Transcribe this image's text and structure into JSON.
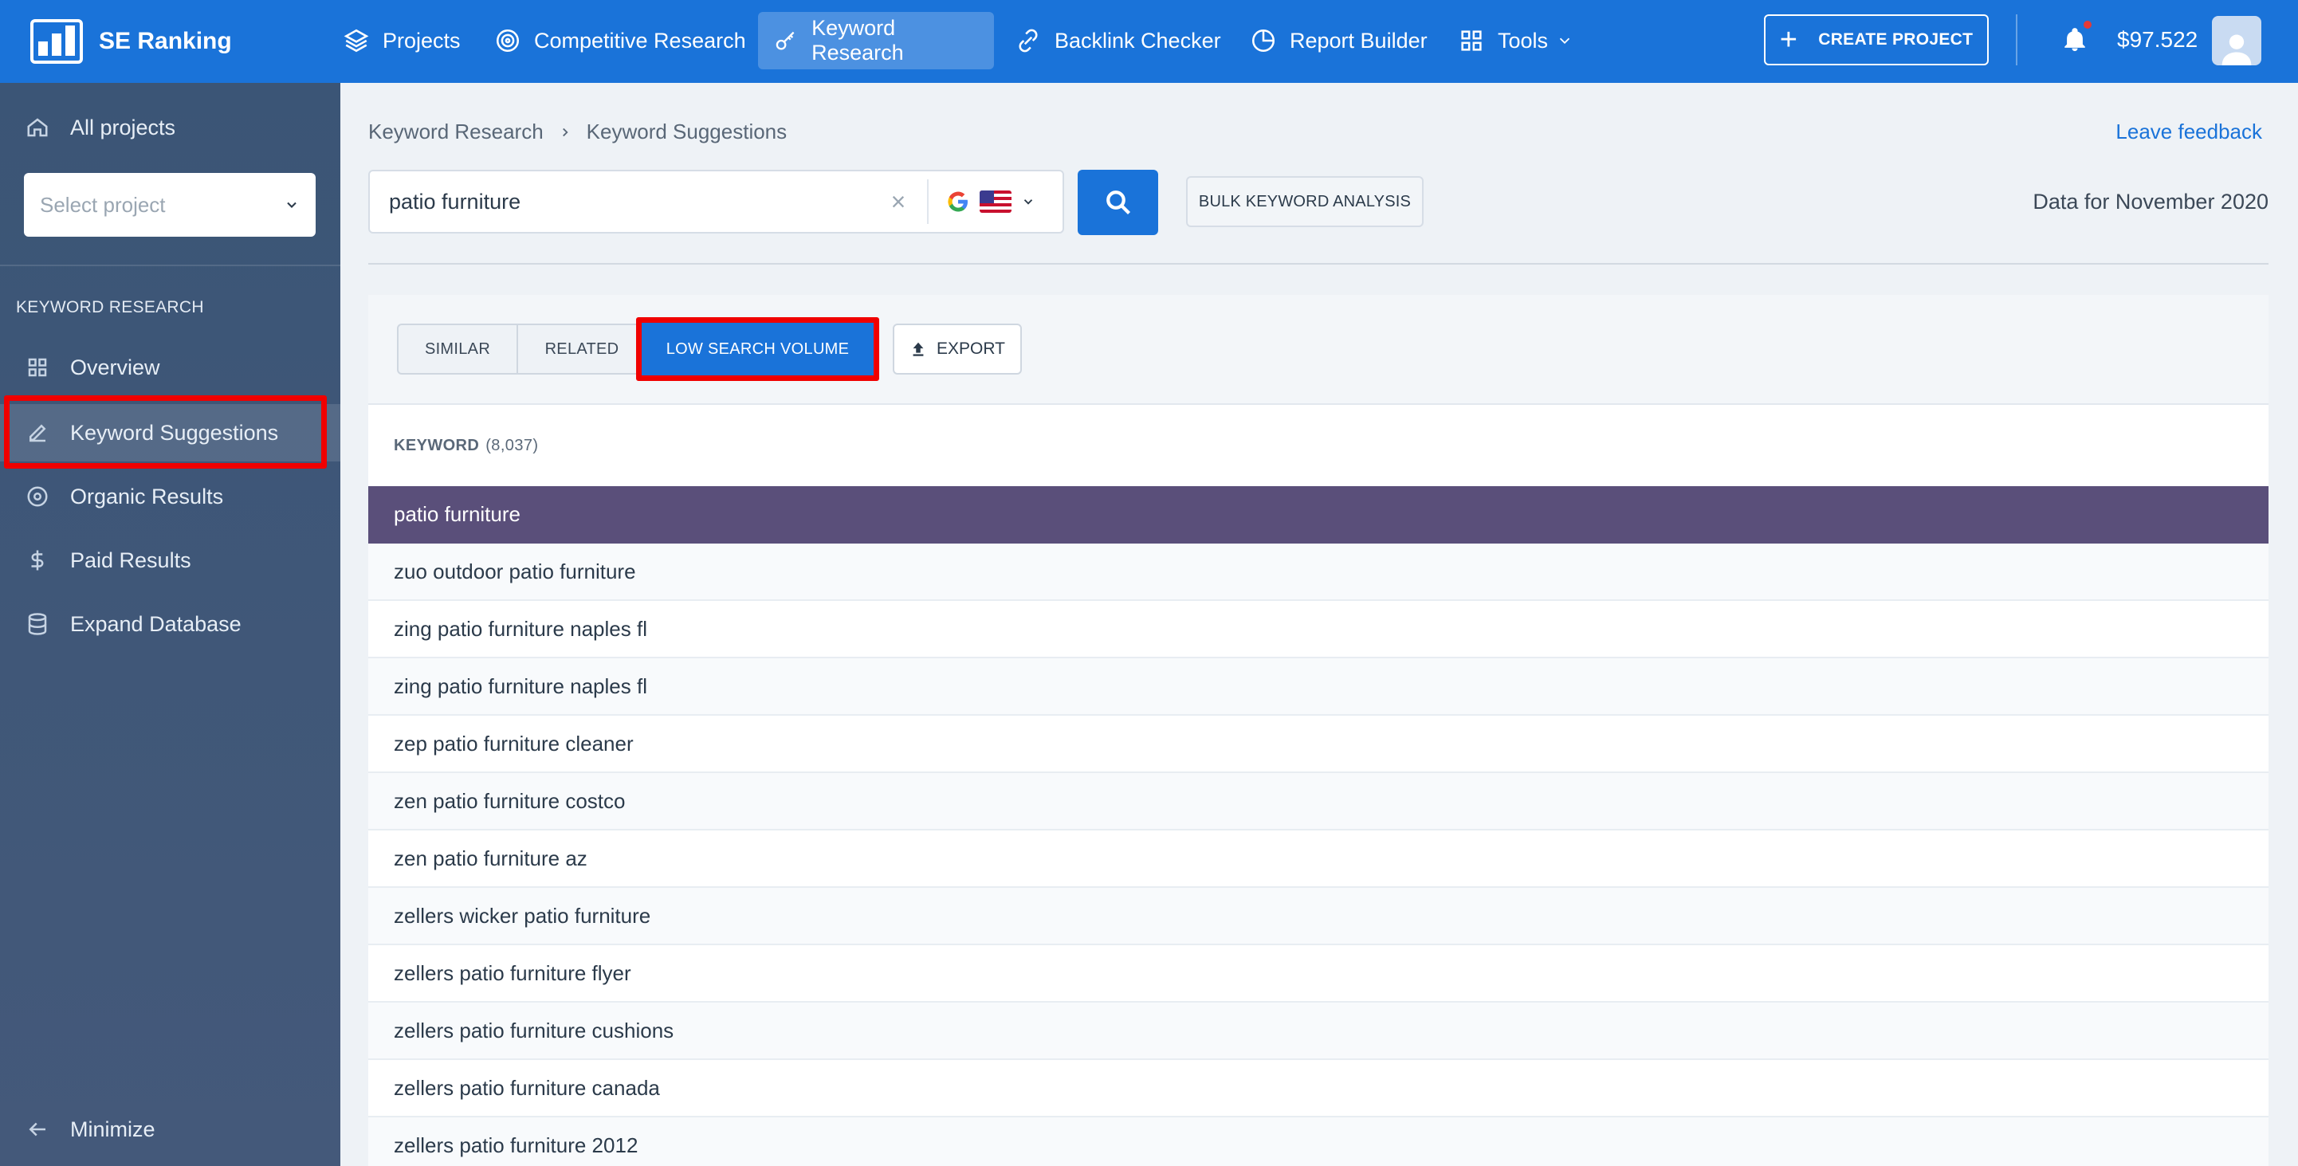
{
  "app": {
    "name": "SE Ranking"
  },
  "nav": {
    "items": [
      {
        "label": "Projects"
      },
      {
        "label": "Competitive Research"
      },
      {
        "label": "Keyword Research"
      },
      {
        "label": "Backlink Checker"
      },
      {
        "label": "Report Builder"
      },
      {
        "label": "Tools"
      }
    ],
    "create_project": "CREATE PROJECT",
    "balance": "$97.522"
  },
  "sidebar": {
    "all_projects": "All projects",
    "select_placeholder": "Select project",
    "section_title": "KEYWORD RESEARCH",
    "items": [
      {
        "label": "Overview"
      },
      {
        "label": "Keyword Suggestions"
      },
      {
        "label": "Organic Results"
      },
      {
        "label": "Paid Results"
      },
      {
        "label": "Expand Database"
      }
    ],
    "minimize": "Minimize"
  },
  "breadcrumb": {
    "root": "Keyword Research",
    "current": "Keyword Suggestions"
  },
  "feedback_link": "Leave feedback",
  "search": {
    "value": "patio furniture",
    "engine": "Google",
    "country": "US"
  },
  "bulk_button": "BULK KEYWORD ANALYSIS",
  "data_for": "Data for November 2020",
  "tabs": {
    "similar": "SIMILAR",
    "related": "RELATED",
    "low_volume": "LOW SEARCH VOLUME"
  },
  "export_button": "EXPORT",
  "table": {
    "header": "KEYWORD",
    "count": "(8,037)",
    "rows": [
      "patio furniture",
      "zuo outdoor patio furniture",
      "zing patio furniture naples fl",
      "zing patio furniture naples fl",
      "zep patio furniture cleaner",
      "zen patio furniture costco",
      "zen patio furniture az",
      "zellers wicker patio furniture",
      "zellers patio furniture flyer",
      "zellers patio furniture cushions",
      "zellers patio furniture canada",
      "zellers patio furniture 2012"
    ]
  },
  "colors": {
    "brand": "#1a73d9",
    "sidebar": "#3b5576",
    "selected_row": "#5a4f7a",
    "highlight": "#f00000"
  }
}
